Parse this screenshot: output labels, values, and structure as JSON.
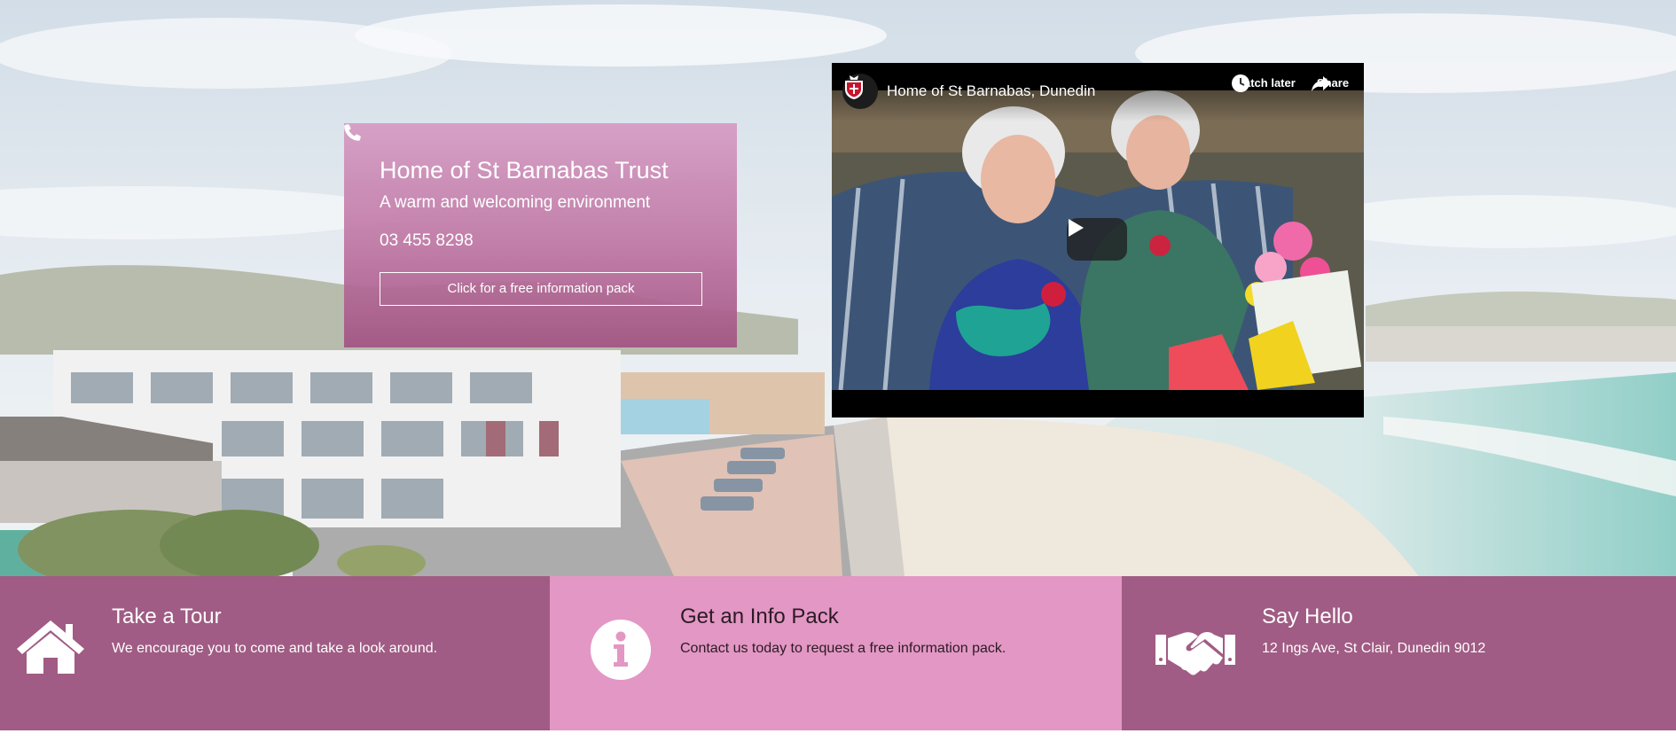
{
  "hero": {
    "info_card": {
      "title": "Home of St Barnabas Trust",
      "subtitle": "A warm and welcoming environment",
      "phone": "03 455 8298",
      "phone_icon": "phone-icon",
      "button_label": "Click for a free information pack"
    },
    "video": {
      "title": "Home of St Barnabas, Dunedin",
      "channel_icon": "crest-logo-icon",
      "watch_later_label": "Watch later",
      "share_label": "Share",
      "play_icon": "play-icon"
    }
  },
  "features": [
    {
      "icon": "house-icon",
      "title": "Take a Tour",
      "text": "We encourage you to come and take a look around."
    },
    {
      "icon": "info-icon",
      "title": "Get an Info Pack",
      "text": "Contact us today to request a free information pack."
    },
    {
      "icon": "handshake-icon",
      "title": "Say Hello",
      "text": "12 Ings Ave, St Clair, Dunedin 9012"
    }
  ],
  "colors": {
    "feature_dark": "#a05c84",
    "feature_light": "#e397c4",
    "card_pink": "#be76a3"
  }
}
